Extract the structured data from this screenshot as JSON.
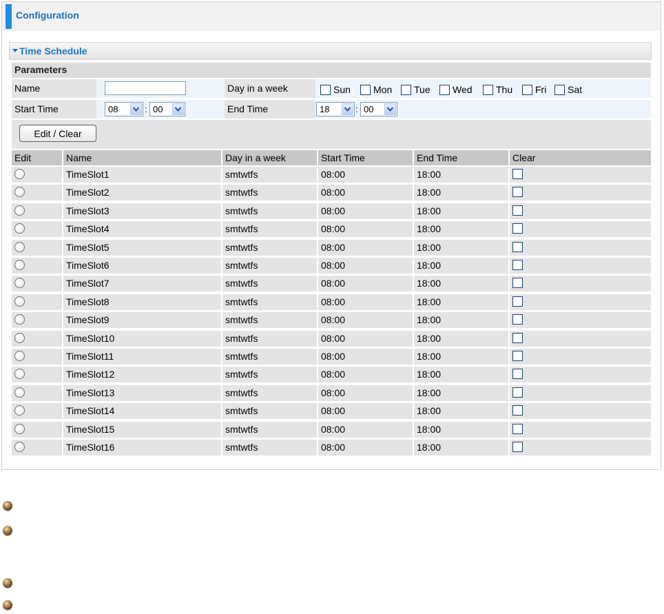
{
  "header": {
    "title": "Configuration"
  },
  "section": {
    "title": "Time Schedule"
  },
  "params": {
    "heading": "Parameters",
    "name_label": "Name",
    "name_value": "",
    "day_label": "Day in a week",
    "days": [
      "Sun",
      "Mon",
      "Tue",
      "Wed",
      "Thu",
      "Fri",
      "Sat"
    ],
    "start_label": "Start Time",
    "start_hour": "08",
    "start_min": "00",
    "end_label": "End Time",
    "end_hour": "18",
    "end_min": "00",
    "colon": ":"
  },
  "actions": {
    "edit_clear_label": "Edit / Clear"
  },
  "table": {
    "headers": [
      "Edit",
      "Name",
      "Day in a week",
      "Start Time",
      "End Time",
      "Clear"
    ],
    "rows": [
      {
        "name": "TimeSlot1",
        "days": "smtwtfs",
        "start": "08:00",
        "end": "18:00"
      },
      {
        "name": "TimeSlot2",
        "days": "smtwtfs",
        "start": "08:00",
        "end": "18:00"
      },
      {
        "name": "TimeSlot3",
        "days": "smtwtfs",
        "start": "08:00",
        "end": "18:00"
      },
      {
        "name": "TimeSlot4",
        "days": "smtwtfs",
        "start": "08:00",
        "end": "18:00"
      },
      {
        "name": "TimeSlot5",
        "days": "smtwtfs",
        "start": "08:00",
        "end": "18:00"
      },
      {
        "name": "TimeSlot6",
        "days": "smtwtfs",
        "start": "08:00",
        "end": "18:00"
      },
      {
        "name": "TimeSlot7",
        "days": "smtwtfs",
        "start": "08:00",
        "end": "18:00"
      },
      {
        "name": "TimeSlot8",
        "days": "smtwtfs",
        "start": "08:00",
        "end": "18:00"
      },
      {
        "name": "TimeSlot9",
        "days": "smtwtfs",
        "start": "08:00",
        "end": "18:00"
      },
      {
        "name": "TimeSlot10",
        "days": "smtwtfs",
        "start": "08:00",
        "end": "18:00"
      },
      {
        "name": "TimeSlot11",
        "days": "smtwtfs",
        "start": "08:00",
        "end": "18:00"
      },
      {
        "name": "TimeSlot12",
        "days": "smtwtfs",
        "start": "08:00",
        "end": "18:00"
      },
      {
        "name": "TimeSlot13",
        "days": "smtwtfs",
        "start": "08:00",
        "end": "18:00"
      },
      {
        "name": "TimeSlot14",
        "days": "smtwtfs",
        "start": "08:00",
        "end": "18:00"
      },
      {
        "name": "TimeSlot15",
        "days": "smtwtfs",
        "start": "08:00",
        "end": "18:00"
      },
      {
        "name": "TimeSlot16",
        "days": "smtwtfs",
        "start": "08:00",
        "end": "18:00"
      }
    ]
  },
  "icons": {
    "bullet": "bronze-bullet-icon",
    "collapse": "triangle-down-icon",
    "dropdown": "chevron-down-icon"
  },
  "colors": {
    "accent": "#1e8ee6",
    "title_blue": "#1d6fb8",
    "row_bg": "#e4e4e4",
    "header_bg": "#c7c7c7",
    "input_row_bg": "#eef4fb"
  }
}
